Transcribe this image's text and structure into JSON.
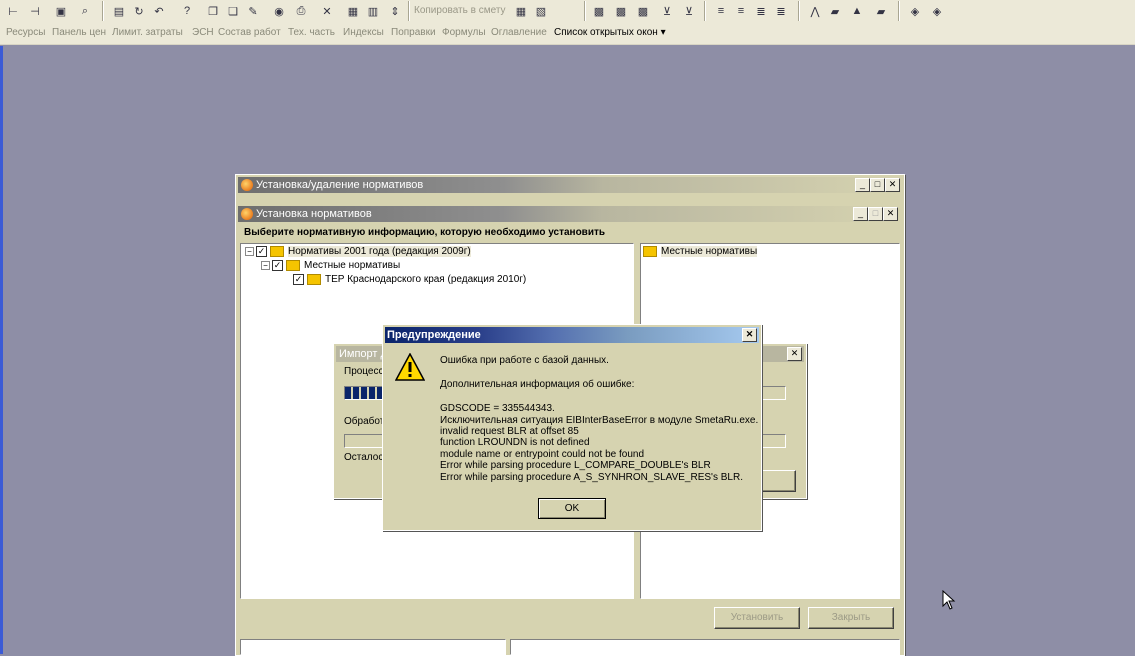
{
  "toolbar": {
    "copy_to_estimate": "Копировать в смету",
    "icons": [
      "tree-icon",
      "tree-sub-icon",
      "window-icon",
      "search-icon",
      "save-icon",
      "refresh-icon",
      "undo-icon",
      "help-icon",
      "copy-icon",
      "paste-icon",
      "comment-icon",
      "car-icon",
      "print-icon",
      "cut-icon",
      "doc-icon",
      "doc2-icon",
      "arrows-icon"
    ]
  },
  "menubar": {
    "items": [
      "Ресурсы",
      "Панель цен",
      "Лимит. затраты",
      "ЭСН",
      "Состав работ",
      "Тех. часть",
      "Индексы",
      "Поправки",
      "Формулы",
      "Оглавление"
    ],
    "open_windows": "Список открытых окон"
  },
  "outer_window": {
    "title": "Установка/удаление нормативов"
  },
  "inner_window": {
    "title": "Установка нормативов",
    "prompt": "Выберите нормативную информацию, которую необходимо установить",
    "tree": [
      "Нормативы 2001 года (редакция 2009г)",
      "Местные нормативы",
      "ТЕР Краснодарского края (редакция 2010г)"
    ],
    "right_item": "Местные нормативы",
    "install_button": "Установить",
    "close_button": "Закрыть"
  },
  "import_window": {
    "title": "Импорт д",
    "process_label": "Процесс",
    "processed_label": "Обработ",
    "remaining_label": "Осталос",
    "progress": 0.18
  },
  "warning_dialog": {
    "title": "Предупреждение",
    "lines": [
      "Ошибка при работе с базой данных.",
      "Дополнительная информация об ошибке:",
      "GDSCODE = 335544343.",
      "Исключительная ситуация EIBInterBaseError в модуле SmetaRu.exe.",
      "invalid request BLR at offset 85",
      "function LROUNDN is not defined",
      "module name or entrypoint could not be found",
      "Error while parsing procedure L_COMPARE_DOUBLE's BLR",
      "Error while parsing procedure A_S_SYNHRON_SLAVE_RES's BLR."
    ],
    "ok_button": "OK"
  }
}
